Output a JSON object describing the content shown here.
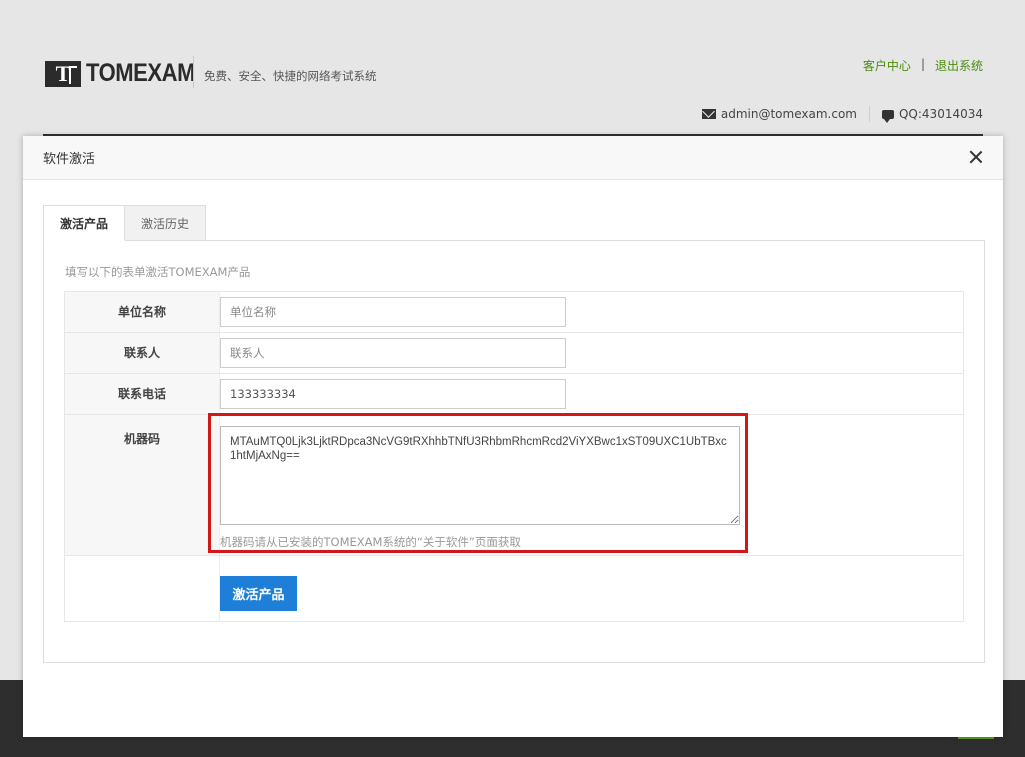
{
  "header": {
    "logo_mark": "T",
    "logo_text": "TOMEXAM",
    "slogan": "免费、安全、快捷的网络考试系统",
    "links": [
      {
        "label": "客户中心"
      },
      {
        "label": "退出系统"
      }
    ],
    "link_separator": "|",
    "email": "admin@tomexam.com",
    "qq": "QQ:43014034"
  },
  "modal": {
    "title": "软件激活",
    "tabs": [
      {
        "label": "激活产品",
        "active": true
      },
      {
        "label": "激活历史",
        "active": false
      }
    ],
    "hint": "填写以下的表单激活TOMEXAM产品",
    "fields": {
      "org_name": {
        "label": "单位名称",
        "placeholder": "单位名称",
        "value": ""
      },
      "contact": {
        "label": "联系人",
        "placeholder": "联系人",
        "value": ""
      },
      "phone": {
        "label": "联系电话",
        "placeholder": "",
        "value": "133333334"
      },
      "machine_code": {
        "label": "机器码",
        "value": "MTAuMTQ0Ljk3LjktRDpca3NcVG9tRXhhbTNfU3RhbmRhcmRcd2ViYXBwc1xST09UXC1UbTBxc1htMjAxNg==",
        "help": "机器码请从已安装的TOMEXAM系统的“关于软件”页面获取"
      }
    },
    "submit_label": "激活产品"
  },
  "colors": {
    "accent_blue": "#1e7fd8",
    "link_green": "#4a8d0e",
    "highlight_red": "#d01818"
  }
}
